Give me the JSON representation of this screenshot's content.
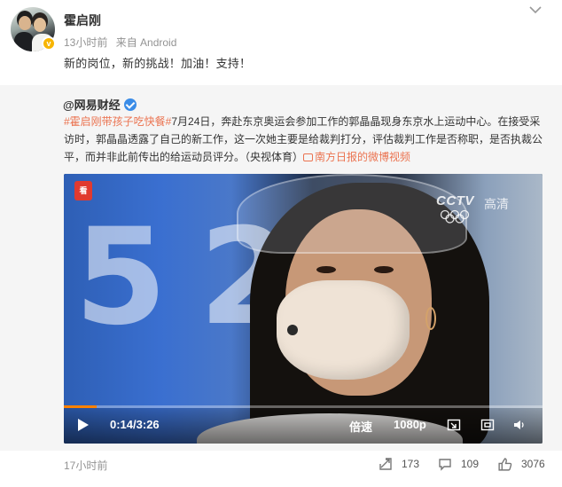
{
  "post": {
    "author": "霍启刚",
    "verified_badge": "v",
    "time": "13小时前",
    "source": "来自 Android",
    "text": "新的岗位，新的挑战！加油！支持！",
    "footer_time": "17小时前",
    "reposts": "173",
    "comments": "109",
    "likes": "3076"
  },
  "repost": {
    "author": "@网易财经",
    "hashtag": "#霍启刚带孩子吃快餐#",
    "body": "7月24日，奔赴东京奥运会参加工作的郭晶晶现身东京水上运动中心。在接受采访时，郭晶晶透露了自己的新工作，这一次她主要是给裁判打分，评估裁判工作是否称职，是否执裁公平，而并非此前传出的给运动员评分。（央视体育）",
    "video_link": "南方日报的微博视频"
  },
  "video": {
    "watermark": "CCTV",
    "quality_label": "高清",
    "bg_number": "5 20",
    "app_logo": "看",
    "time": "0:14/3:26",
    "progress": 0.068,
    "speed_label": "倍速",
    "resolution": "1080p"
  },
  "colors": {
    "accent_orange": "#ff8200",
    "topic_orange": "#eb7350",
    "verified_blue": "#3a8ce7",
    "verified_gold": "#f7b500"
  }
}
